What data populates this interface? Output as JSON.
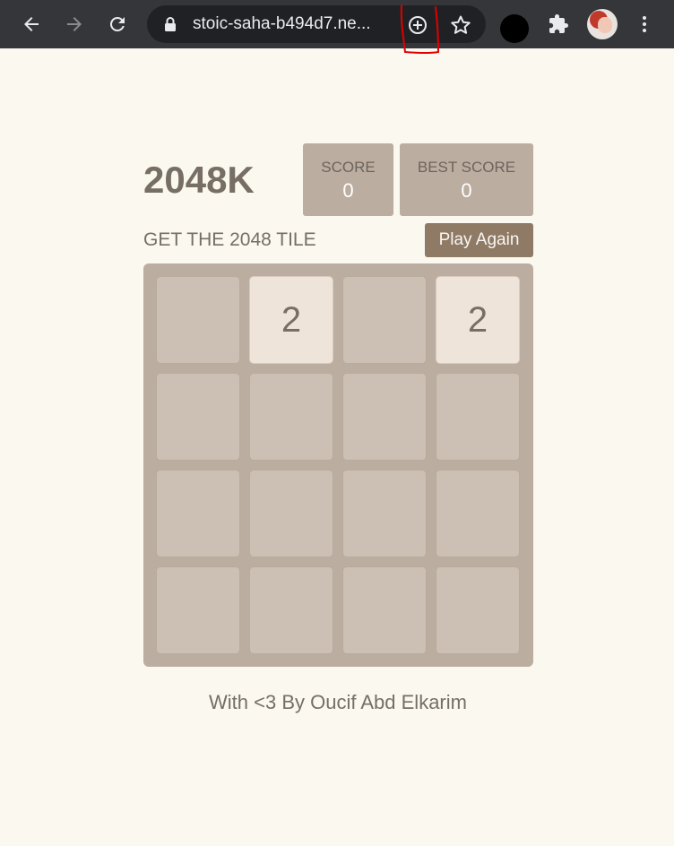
{
  "browser": {
    "url": "stoic-saha-b494d7.ne...",
    "icons": {
      "back": "arrow-left-icon",
      "forward": "arrow-right-icon",
      "reload": "reload-icon",
      "lock": "lock-icon",
      "zoom": "zoom-in-circle-icon",
      "bookmark": "star-icon",
      "extensions": "puzzle-icon",
      "menu": "more-vertical-icon"
    }
  },
  "game": {
    "title": "2048K",
    "score_label": "SCORE",
    "score_value": "0",
    "best_label": "BEST SCORE",
    "best_value": "0",
    "subtitle": "GET THE 2048 TILE",
    "play_again": "Play Again",
    "tiles": [
      "",
      "2",
      "",
      "2",
      "",
      "",
      "",
      "",
      "",
      "",
      "",
      "",
      "",
      "",
      "",
      ""
    ]
  },
  "footer": "With <3 By Oucif Abd Elkarim",
  "colors": {
    "page_bg": "#faf8ef",
    "board": "#bbada0",
    "tile_2": "#eee4da",
    "button": "#8f7a66",
    "text": "#776e65",
    "toolbar": "#35363a",
    "annotation": "#e00000"
  }
}
